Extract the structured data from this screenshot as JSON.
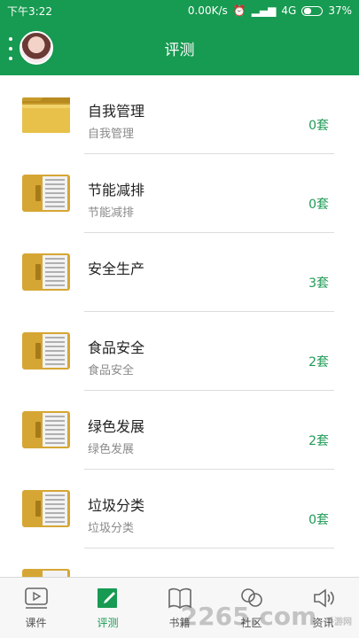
{
  "status": {
    "time": "下午3:22",
    "net_speed": "0.00K/s",
    "signal": "4G",
    "battery": "37%"
  },
  "header": {
    "title": "评测"
  },
  "items": [
    {
      "name": "自我管理",
      "sub": "自我管理",
      "count": "0套",
      "icon": "folder-icon"
    },
    {
      "name": "节能减排",
      "sub": "节能减排",
      "count": "0套",
      "icon": "binder-icon"
    },
    {
      "name": "安全生产",
      "sub": "",
      "count": "3套",
      "icon": "binder-icon"
    },
    {
      "name": "食品安全",
      "sub": "食品安全",
      "count": "2套",
      "icon": "binder-icon"
    },
    {
      "name": "绿色发展",
      "sub": "绿色发展",
      "count": "2套",
      "icon": "binder-icon"
    },
    {
      "name": "垃圾分类",
      "sub": "垃圾分类",
      "count": "0套",
      "icon": "binder-icon"
    }
  ],
  "tabs": [
    {
      "label": "课件",
      "icon": "play-icon",
      "active": false
    },
    {
      "label": "评测",
      "icon": "edit-icon",
      "active": true
    },
    {
      "label": "书籍",
      "icon": "book-icon",
      "active": false
    },
    {
      "label": "社区",
      "icon": "chat-icon",
      "active": false
    },
    {
      "label": "资讯",
      "icon": "speaker-icon",
      "active": false
    }
  ],
  "watermark": {
    "text": "2265.com",
    "sub": "手游网"
  },
  "colors": {
    "primary": "#179a51",
    "count": "#1f9a55"
  }
}
